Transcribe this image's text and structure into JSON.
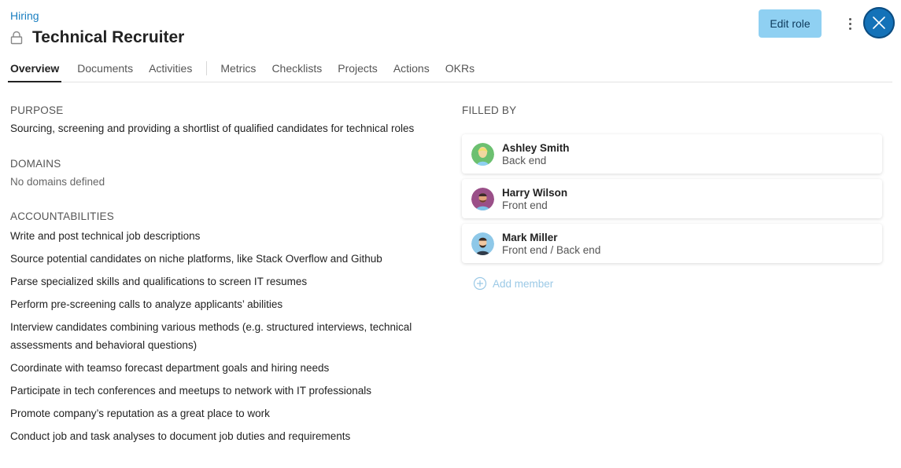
{
  "breadcrumb": "Hiring",
  "title": "Technical Recruiter",
  "header": {
    "edit_label": "Edit role"
  },
  "tabs": [
    "Overview",
    "Documents",
    "Activities",
    "Metrics",
    "Checklists",
    "Projects",
    "Actions",
    "OKRs"
  ],
  "purpose": {
    "heading": "PURPOSE",
    "text": "Sourcing, screening and providing a shortlist of qualified candidates for technical roles"
  },
  "domains": {
    "heading": "DOMAINS",
    "text": "No domains defined"
  },
  "accountabilities": {
    "heading": "ACCOUNTABILITIES",
    "items": [
      "Write and post technical job descriptions",
      "Source potential candidates on niche platforms, like Stack Overflow and Github",
      "Parse specialized skills and qualifications to screen IT resumes",
      "Perform pre-screening calls to analyze applicants’ abilities",
      "Interview candidates combining various methods (e.g. structured interviews, technical assessments and behavioral questions)",
      "Coordinate with teamso forecast department goals and hiring needs",
      "Participate in tech conferences and meetups to network with IT professionals",
      "Promote company’s reputation as a great place to work",
      "Conduct job and task analyses to document job duties and requirements"
    ]
  },
  "filled_by": {
    "heading": "FILLED BY",
    "members": [
      {
        "name": "Ashley Smith",
        "role": "Back end"
      },
      {
        "name": "Harry Wilson",
        "role": "Front end"
      },
      {
        "name": "Mark Miller",
        "role": "Front end / Back end"
      }
    ],
    "add_label": "Add member"
  },
  "colors": {
    "accent": "#1a7fc1",
    "edit_button_bg": "#8fd0f2",
    "close_button_bg": "#1472b8",
    "add_member": "#9bc9e6"
  },
  "icons": {
    "lock": "lock-icon",
    "more": "more-vertical-icon",
    "close": "close-icon",
    "add": "plus-circle-icon"
  }
}
